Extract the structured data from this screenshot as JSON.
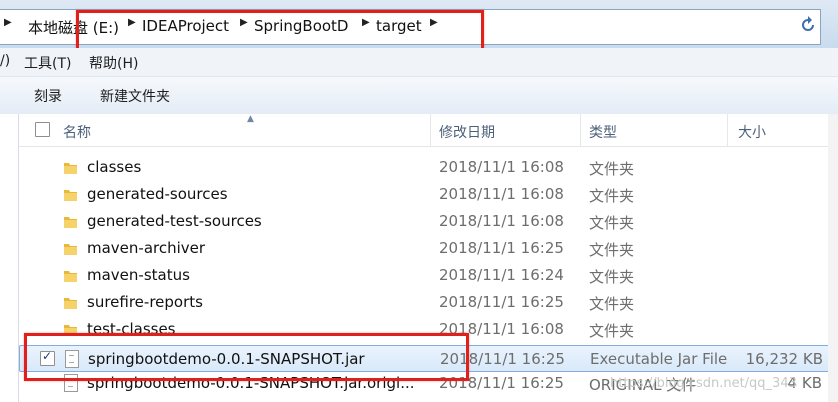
{
  "address": {
    "crumbs": [
      "本地磁盘 (E:)",
      "IDEAProject",
      "SpringBootD",
      "target"
    ]
  },
  "menu": [
    "/)",
    "工具(T)",
    "帮助(H)"
  ],
  "toolbar": {
    "burn": "刻录",
    "new_folder": "新建文件夹"
  },
  "columns": {
    "name": "名称",
    "date": "修改日期",
    "type": "类型",
    "size": "大小"
  },
  "files": [
    {
      "name": "classes",
      "date": "2018/11/1 16:08",
      "type": "文件夹",
      "size": "",
      "icon": "folder-icon"
    },
    {
      "name": "generated-sources",
      "date": "2018/11/1 16:08",
      "type": "文件夹",
      "size": "",
      "icon": "folder-icon"
    },
    {
      "name": "generated-test-sources",
      "date": "2018/11/1 16:08",
      "type": "文件夹",
      "size": "",
      "icon": "folder-icon"
    },
    {
      "name": "maven-archiver",
      "date": "2018/11/1 16:25",
      "type": "文件夹",
      "size": "",
      "icon": "folder-icon"
    },
    {
      "name": "maven-status",
      "date": "2018/11/1 16:24",
      "type": "文件夹",
      "size": "",
      "icon": "folder-icon"
    },
    {
      "name": "surefire-reports",
      "date": "2018/11/1 16:25",
      "type": "文件夹",
      "size": "",
      "icon": "folder-icon"
    },
    {
      "name": "test-classes",
      "date": "2018/11/1 16:08",
      "type": "文件夹",
      "size": "",
      "icon": "folder-icon"
    },
    {
      "name": "springbootdemo-0.0.1-SNAPSHOT.jar",
      "date": "2018/11/1 16:25",
      "type": "Executable Jar File",
      "size": "16,232 KB",
      "icon": "jar-file-icon",
      "selected": true
    },
    {
      "name": "springbootdemo-0.0.1-SNAPSHOT.jar.origi...",
      "date": "2018/11/1 16:25",
      "type": "ORIGINAL 文件",
      "size": "4 KB",
      "icon": "file-icon"
    }
  ],
  "watermark": "https://blog.csdn.net/qq_343",
  "colors": {
    "highlight": "#e0211b",
    "selection": "#d9e9fa",
    "folder": "#e8b83a"
  }
}
